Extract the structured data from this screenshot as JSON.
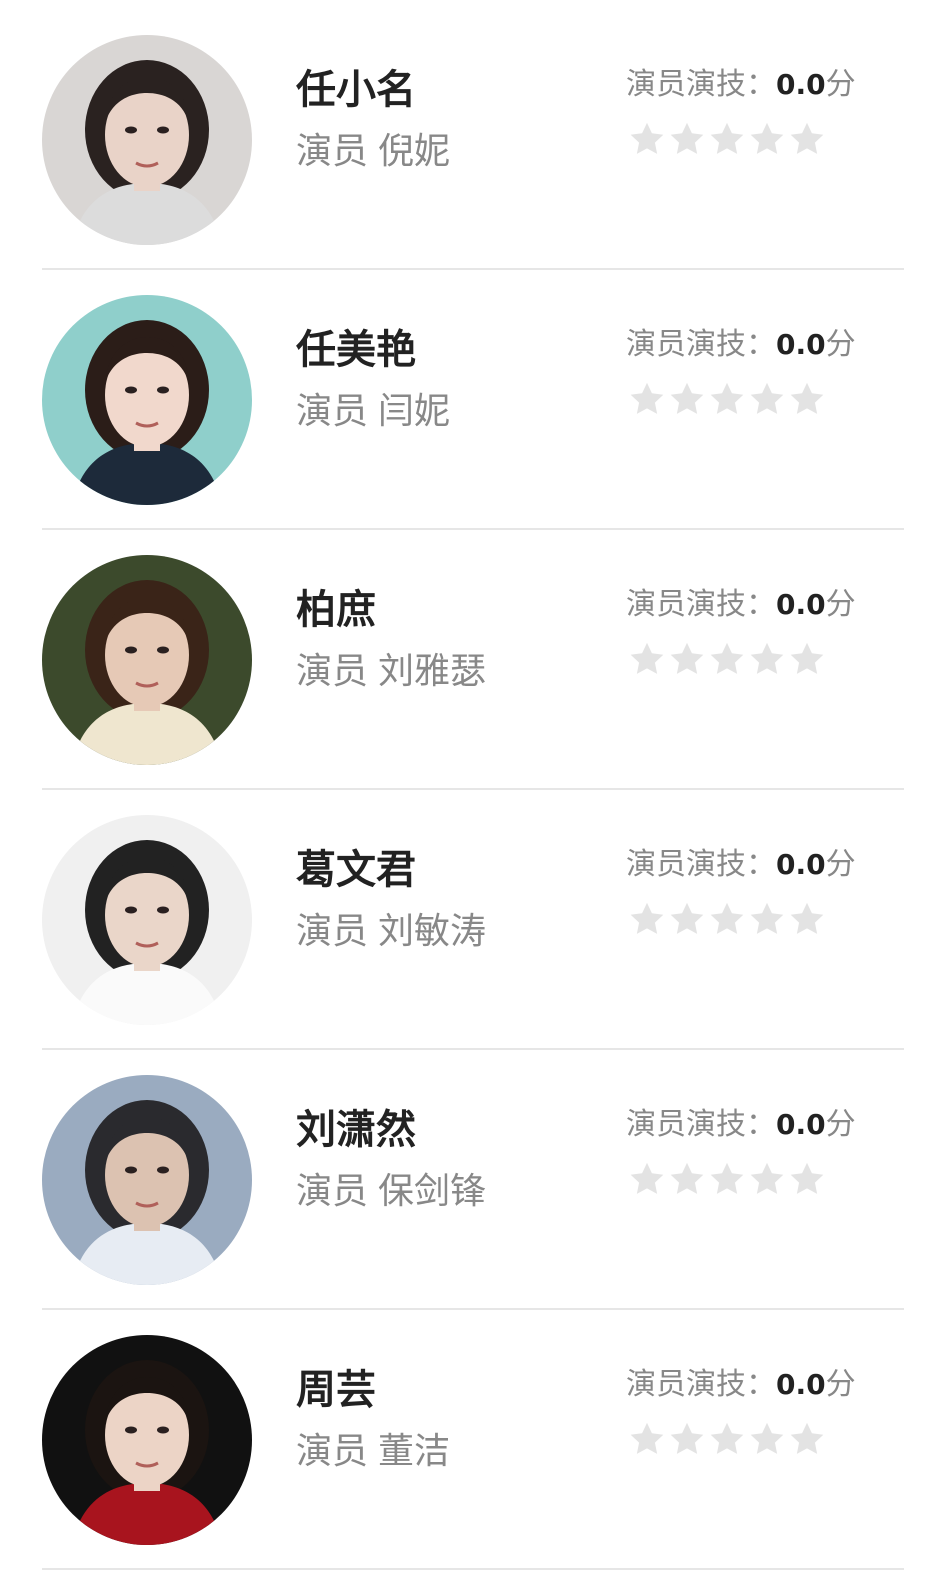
{
  "rating_label": "演员演技：",
  "score_unit": "分",
  "role_prefix": "演员",
  "colors": {
    "star_empty": "#e3e3e3",
    "divider": "#e6e6e6",
    "title_text": "#222222",
    "secondary_text": "#888888"
  },
  "cast": [
    {
      "role": "任小名",
      "actor": "倪妮",
      "score": "0.0",
      "stars_filled": 0,
      "stars_total": 5,
      "avatar_bg": "#d9d6d4",
      "hair": "#2a2220",
      "skin": "#e9d3c8",
      "cloth": "#dcdcdc"
    },
    {
      "role": "任美艳",
      "actor": "闫妮",
      "score": "0.0",
      "stars_filled": 0,
      "stars_total": 5,
      "avatar_bg": "#8fcfcb",
      "hair": "#2b1d18",
      "skin": "#f1d8cc",
      "cloth": "#1d2a3a"
    },
    {
      "role": "柏庶",
      "actor": "刘雅瑟",
      "score": "0.0",
      "stars_filled": 0,
      "stars_total": 5,
      "avatar_bg": "#3c4a2c",
      "hair": "#3a2418",
      "skin": "#e6c9b6",
      "cloth": "#efe6cf"
    },
    {
      "role": "葛文君",
      "actor": "刘敏涛",
      "score": "0.0",
      "stars_filled": 0,
      "stars_total": 5,
      "avatar_bg": "#f0f0f0",
      "hair": "#222222",
      "skin": "#ead6c9",
      "cloth": "#fafafa"
    },
    {
      "role": "刘潇然",
      "actor": "保剑锋",
      "score": "0.0",
      "stars_filled": 0,
      "stars_total": 5,
      "avatar_bg": "#9aabc0",
      "hair": "#2a2a2e",
      "skin": "#dcc2b1",
      "cloth": "#e7ecf3"
    },
    {
      "role": "周芸",
      "actor": "董洁",
      "score": "0.0",
      "stars_filled": 0,
      "stars_total": 5,
      "avatar_bg": "#111111",
      "hair": "#1b1411",
      "skin": "#ecd4c6",
      "cloth": "#a8141e"
    }
  ]
}
